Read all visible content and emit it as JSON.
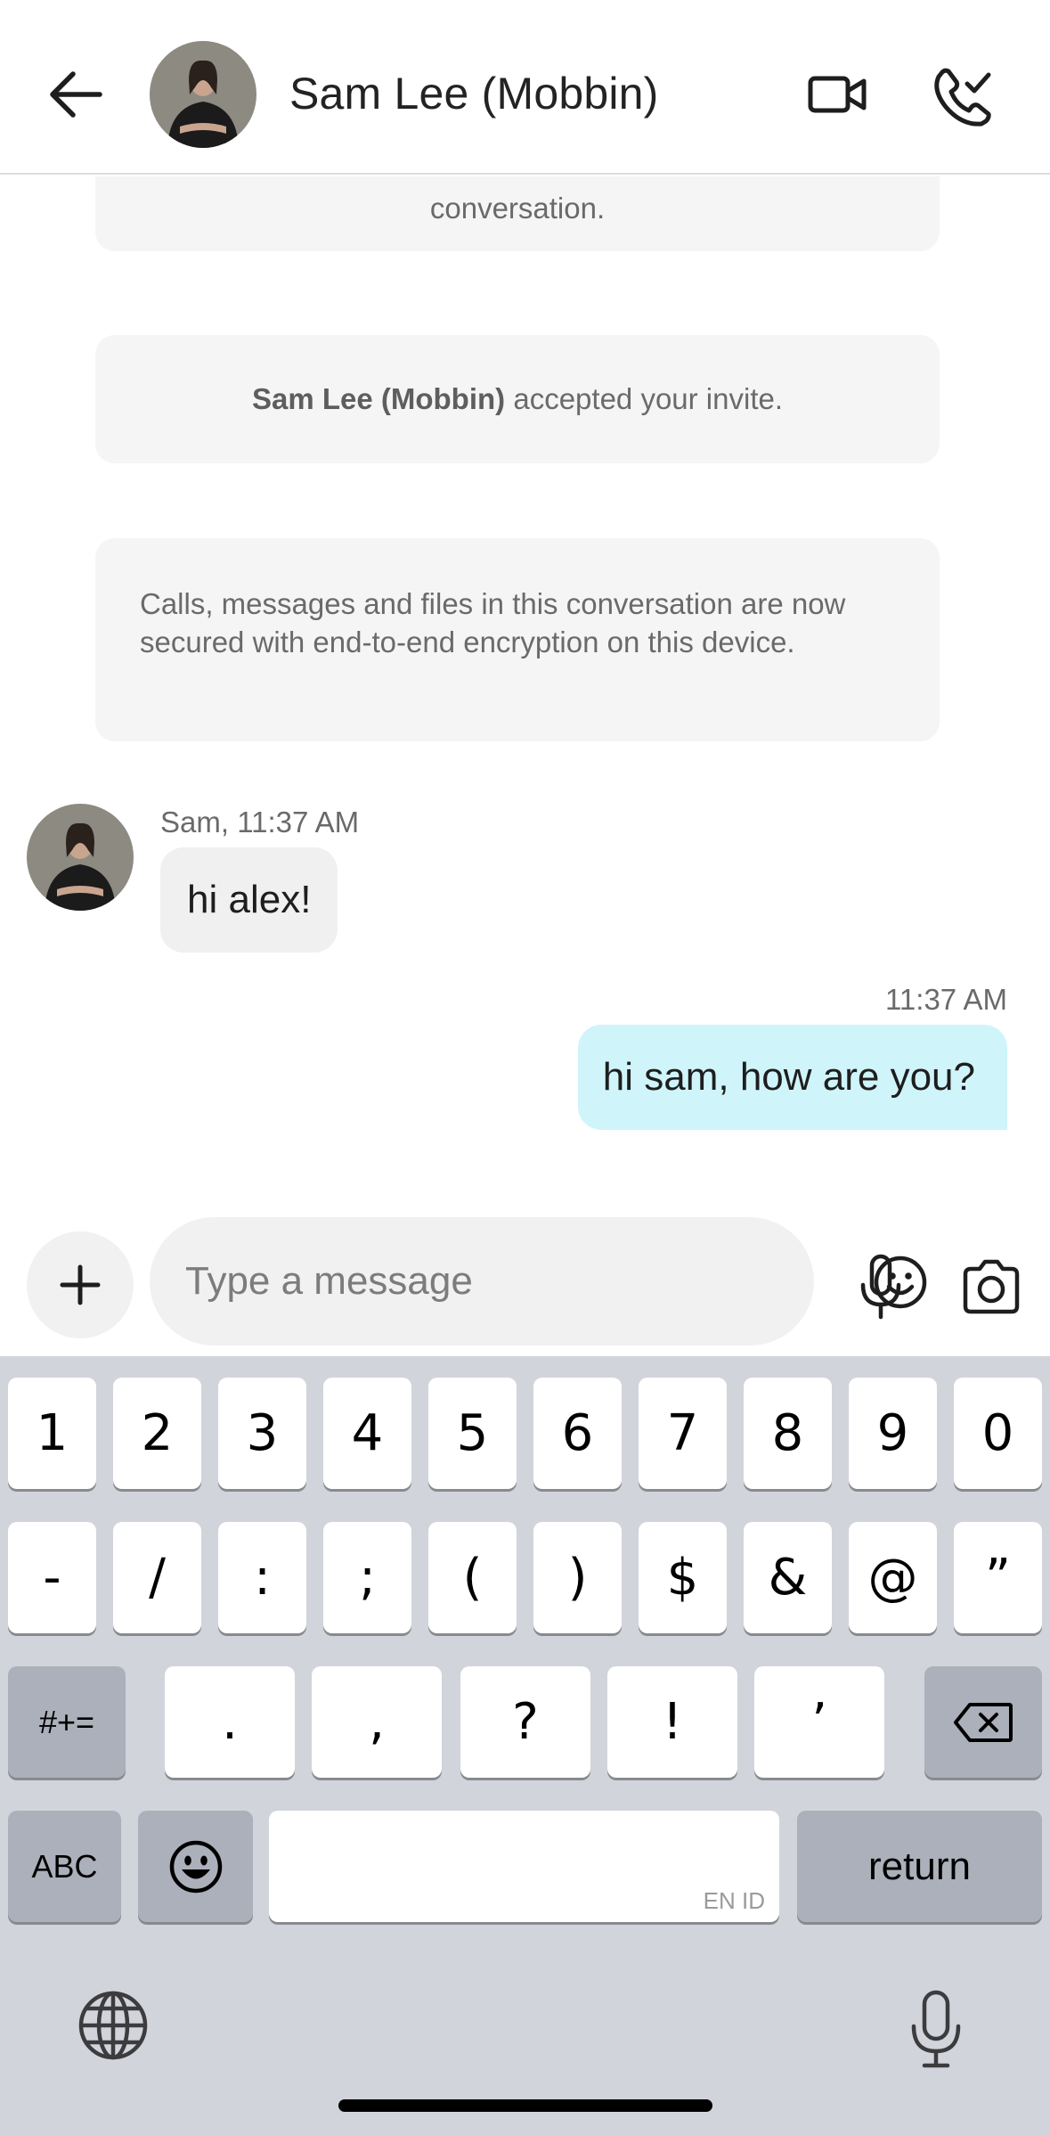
{
  "header": {
    "title": "Sam Lee (Mobbin)",
    "back_icon": "back-arrow-icon",
    "video_icon": "video-camera-icon",
    "call_icon": "phone-icon"
  },
  "conversation": {
    "partial_notice": "conversation.",
    "invite_notice_name": "Sam Lee (Mobbin)",
    "invite_notice_text": " accepted your invite.",
    "encryption_notice": "Calls, messages and files in this conversation are now secured with end-to-end encryption on this device.",
    "messages": [
      {
        "direction": "incoming",
        "meta": "Sam, 11:37 AM",
        "text": "hi alex!"
      },
      {
        "direction": "outgoing",
        "meta": "11:37 AM",
        "text": "hi sam, how are you?"
      }
    ]
  },
  "composer": {
    "placeholder": "Type a message",
    "value": ""
  },
  "keyboard": {
    "row1": [
      "1",
      "2",
      "3",
      "4",
      "5",
      "6",
      "7",
      "8",
      "9",
      "0"
    ],
    "row2": [
      "-",
      "/",
      ":",
      ";",
      "(",
      ")",
      "$",
      "&",
      "@",
      "”"
    ],
    "row3": [
      ".",
      ",",
      "?",
      "!",
      "’"
    ],
    "symbols_key": "#+=",
    "abc_key": "ABC",
    "return_key": "return",
    "space_hint": "EN ID"
  },
  "colors": {
    "outgoing_bubble": "#cff5fb",
    "incoming_bubble": "#f0f0f0",
    "system_card": "#f5f5f5",
    "keyboard_bg": "#d1d4da"
  }
}
